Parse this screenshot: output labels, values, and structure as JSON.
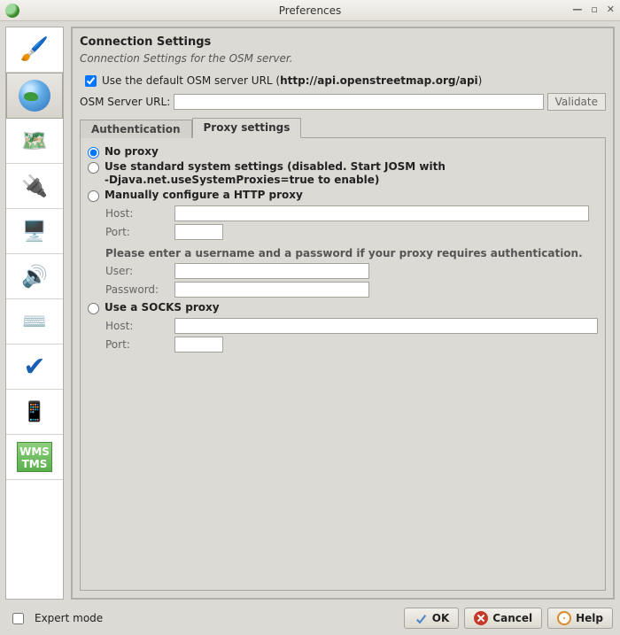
{
  "window": {
    "title": "Preferences"
  },
  "sidebar": {
    "items": [
      {
        "id": "display",
        "icon": "🖌️"
      },
      {
        "id": "connection",
        "icon": "globe"
      },
      {
        "id": "map",
        "icon": "🗺️"
      },
      {
        "id": "plugins",
        "icon": "🔌"
      },
      {
        "id": "toolbar",
        "icon": "🖥️"
      },
      {
        "id": "audio",
        "icon": "🔊"
      },
      {
        "id": "shortcuts",
        "icon": "⌨️"
      },
      {
        "id": "validator",
        "icon": "✔"
      },
      {
        "id": "remote",
        "icon": "📱"
      },
      {
        "id": "wms",
        "line1": "WMS",
        "line2": "TMS"
      }
    ]
  },
  "panel": {
    "title": "Connection Settings",
    "subtitle": "Connection Settings for the OSM server.",
    "use_default_prefix": "Use the default OSM server URL (",
    "use_default_url": "http://api.openstreetmap.org/api",
    "use_default_suffix": ")",
    "use_default_checked": true,
    "server_url_label": "OSM Server URL:",
    "server_url_value": "",
    "validate_label": "Validate"
  },
  "tabs": {
    "auth": "Authentication",
    "proxy": "Proxy settings"
  },
  "proxy": {
    "no_proxy": "No proxy",
    "system_l1": "Use standard system settings (disabled. Start JOSM with",
    "system_l2": "-Djava.net.useSystemProxies=true to enable)",
    "manual": "Manually configure a HTTP proxy",
    "host_label": "Host:",
    "port_label": "Port:",
    "auth_hint": "Please enter a username and a password if your proxy requires authentication.",
    "user_label": "User:",
    "password_label": "Password:",
    "socks": "Use a SOCKS proxy",
    "http_host": "",
    "http_port": "",
    "http_user": "",
    "http_password": "",
    "socks_host": "",
    "socks_port": ""
  },
  "bottom": {
    "expert_mode": "Expert mode",
    "expert_checked": false,
    "ok": "OK",
    "cancel": "Cancel",
    "help": "Help"
  }
}
